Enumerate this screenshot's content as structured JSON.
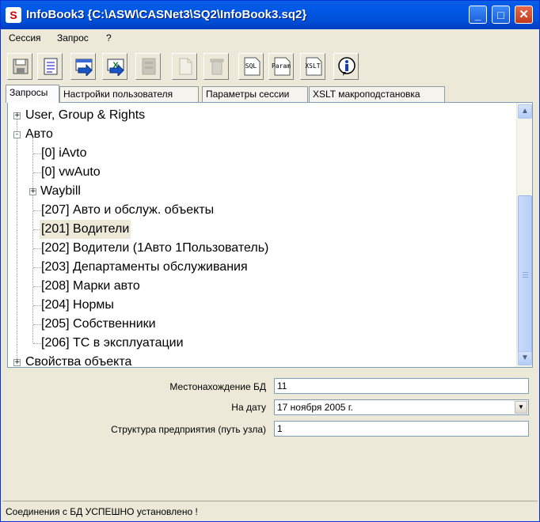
{
  "window": {
    "title": "InfoBook3 {C:\\ASW\\CASNet3\\SQ2\\InfoBook3.sq2}"
  },
  "title_buttons": {
    "minimize": "_",
    "maximize": "□",
    "close": "✕"
  },
  "menu": [
    "Сессия",
    "Запрос",
    "?"
  ],
  "toolbar": {
    "buttons": [
      {
        "icon": "save-icon"
      },
      {
        "icon": "document-list-icon"
      },
      {
        "icon": "export-arrow-icon"
      },
      {
        "icon": "excel-export-icon"
      },
      {
        "icon": "report-icon",
        "disabled": true
      },
      {
        "icon": "new-document-icon",
        "disabled": true
      },
      {
        "icon": "trash-icon",
        "disabled": true
      },
      {
        "icon": "sql-icon",
        "label": "SQL"
      },
      {
        "icon": "param-icon",
        "label": "Param"
      },
      {
        "icon": "xslt-icon",
        "label": "XSLT"
      },
      {
        "icon": "info-icon"
      }
    ]
  },
  "tabs": [
    "Запросы",
    "Настройки пользователя",
    "Параметры сессии",
    "XSLT макроподстановка"
  ],
  "tree": [
    {
      "label": "User, Group & Rights",
      "level": 0,
      "expander": "+"
    },
    {
      "label": "Авто",
      "level": 0,
      "expander": "-"
    },
    {
      "label": "[0] iAvto",
      "level": 1
    },
    {
      "label": "[0] vwAuto",
      "level": 1
    },
    {
      "label": "Waybill",
      "level": 1,
      "expander": "+"
    },
    {
      "label": "[207] Авто и обслуж. объекты",
      "level": 1
    },
    {
      "label": "[201] Водители",
      "level": 1,
      "selected": true
    },
    {
      "label": "[202] Водители (1Авто 1Пользователь)",
      "level": 1
    },
    {
      "label": "[203] Департаменты обслуживания",
      "level": 1
    },
    {
      "label": "[208] Марки  авто",
      "level": 1
    },
    {
      "label": "[204] Нормы",
      "level": 1
    },
    {
      "label": "[205] Собственники",
      "level": 1
    },
    {
      "label": "[206] ТС в эксплуатации",
      "level": 1
    },
    {
      "label": "Свойства объекта",
      "level": 0,
      "expander": "+"
    }
  ],
  "scrollbar": {
    "up": "▲",
    "down": "▼",
    "grip": "≡"
  },
  "form": {
    "db_location_label": "Местонахождение БД",
    "db_location_value": "11",
    "date_label": "На дату",
    "date_value": "17  ноября  2005 г.",
    "date_arrow": "▼",
    "structure_label": "Структура предприятия (путь узла)",
    "structure_value": "1"
  },
  "status": "Соединения с БД УСПЕШНО установлено !"
}
